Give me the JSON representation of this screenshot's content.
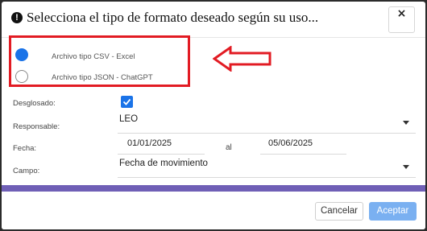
{
  "dialog": {
    "title": "Selecciona el tipo de formato deseado según su uso...",
    "close_label": "×"
  },
  "format_options": [
    {
      "label": "Archivo tipo CSV - Excel",
      "selected": true
    },
    {
      "label": "Archivo tipo JSON - ChatGPT",
      "selected": false
    }
  ],
  "form": {
    "desglosado_label": "Desglosado:",
    "desglosado_checked": true,
    "responsable_label": "Responsable:",
    "responsable_value": "LEO",
    "fecha_label": "Fecha:",
    "fecha_from": "01/01/2025",
    "fecha_separator": "al",
    "fecha_to": "05/06/2025",
    "campo_label": "Campo:",
    "campo_value": "Fecha de movimiento"
  },
  "footer": {
    "cancel_label": "Cancelar",
    "accept_label": "Aceptar"
  },
  "colors": {
    "highlight": "#e21b23",
    "accent": "#1a73e8",
    "band": "#6f5fb6",
    "accept_button": "#7ab0f1"
  }
}
